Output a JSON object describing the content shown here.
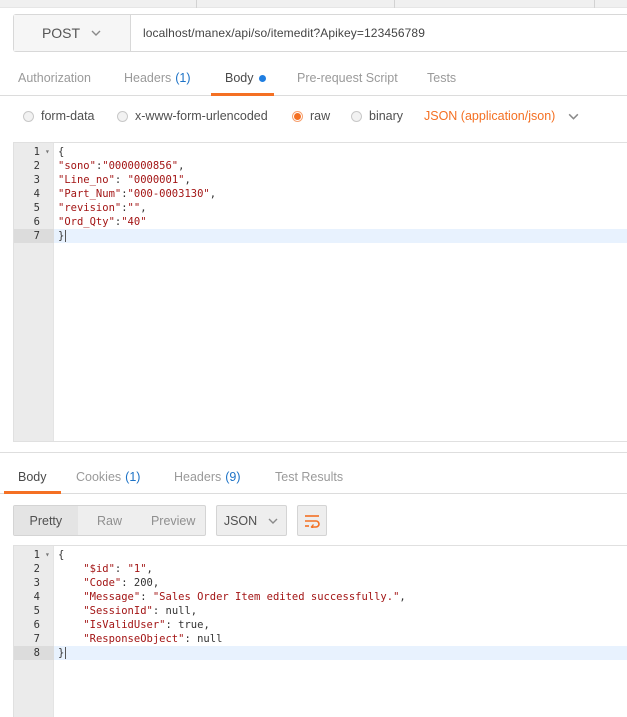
{
  "request": {
    "method": "POST",
    "url": "localhost/manex/api/so/itemedit?Apikey=123456789"
  },
  "request_tabs": [
    {
      "label": "Authorization",
      "count": ""
    },
    {
      "label": "Headers",
      "count": "(1)"
    },
    {
      "label": "Body",
      "count": ""
    },
    {
      "label": "Pre-request Script",
      "count": ""
    },
    {
      "label": "Tests",
      "count": ""
    }
  ],
  "body_options": {
    "form_data": "form-data",
    "urlencoded": "x-www-form-urlencoded",
    "raw": "raw",
    "binary": "binary",
    "content_type": "JSON (application/json)"
  },
  "request_body": {
    "line_numbers": [
      "1",
      "2",
      "3",
      "4",
      "5",
      "6",
      "7"
    ],
    "open_brace": "{",
    "close_brace": "}",
    "fields": [
      {
        "key": "\"sono\"",
        "sep": ":",
        "value": "\"0000000856\"",
        "tail": ","
      },
      {
        "key": "\"Line_no\"",
        "sep": ": ",
        "value": "\"0000001\"",
        "tail": ","
      },
      {
        "key": "\"Part_Num\"",
        "sep": ":",
        "value": "\"000-0003130\"",
        "tail": ","
      },
      {
        "key": "\"revision\"",
        "sep": ":",
        "value": "\"\"",
        "tail": ","
      },
      {
        "key": "\"Ord_Qty\"",
        "sep": ":",
        "value": "\"40\"",
        "tail": ""
      }
    ]
  },
  "response_tabs": [
    {
      "label": "Body",
      "count": ""
    },
    {
      "label": "Cookies",
      "count": "(1)"
    },
    {
      "label": "Headers",
      "count": "(9)"
    },
    {
      "label": "Test Results",
      "count": ""
    }
  ],
  "response_toolbar": {
    "pretty": "Pretty",
    "raw": "Raw",
    "preview": "Preview",
    "format": "JSON"
  },
  "response_body": {
    "line_numbers": [
      "1",
      "2",
      "3",
      "4",
      "5",
      "6",
      "7",
      "8"
    ],
    "open_brace": "{",
    "close_brace": "}",
    "fields": [
      {
        "key": "\"$id\"",
        "value": "\"1\"",
        "tail": ","
      },
      {
        "key": "\"Code\"",
        "value": "200",
        "tail": ","
      },
      {
        "key": "\"Message\"",
        "value": "\"Sales Order Item edited successfully.\"",
        "tail": ","
      },
      {
        "key": "\"SessionId\"",
        "value": "null",
        "tail": ","
      },
      {
        "key": "\"IsValidUser\"",
        "value": "true",
        "tail": ","
      },
      {
        "key": "\"ResponseObject\"",
        "value": "null",
        "tail": ""
      }
    ]
  },
  "colors": {
    "accent": "#f47023",
    "count_blue": "#1c72c6",
    "active_line": "#e8f2fe",
    "json_string": "#a31515"
  },
  "icons": {
    "method_dropdown": "chevron-down-icon",
    "content_type_dropdown": "chevron-down-icon",
    "format_dropdown": "chevron-down-icon",
    "wrap": "wrap-lines-icon",
    "modified": "dot-icon"
  }
}
